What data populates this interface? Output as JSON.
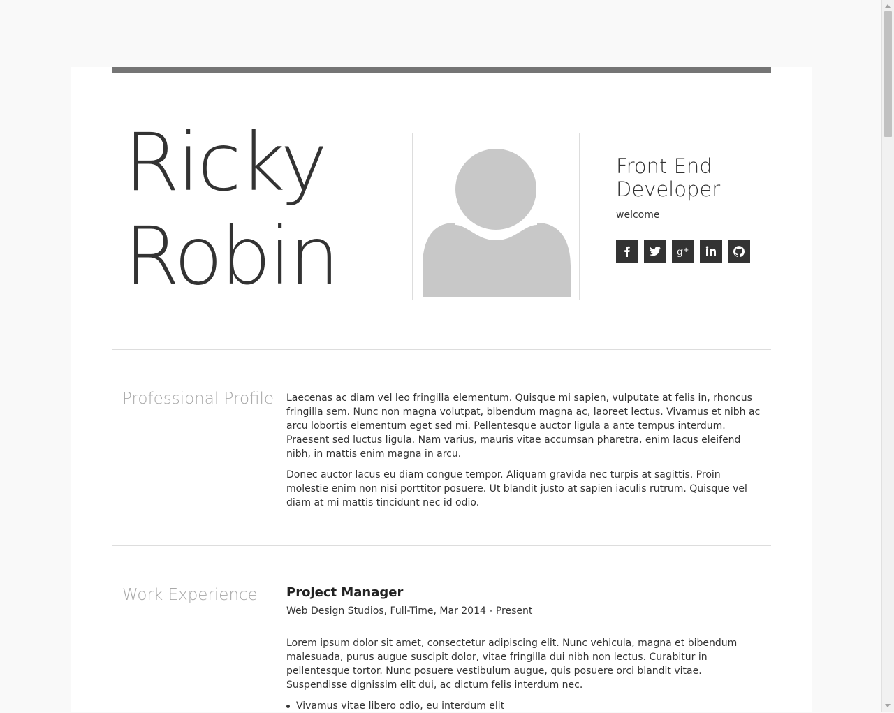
{
  "header": {
    "first_name": "Ricky",
    "last_name": "Robin",
    "role_line1": "Front End",
    "role_line2": "Developer",
    "tagline": "welcome"
  },
  "social": [
    {
      "name": "facebook-icon",
      "glyph": "f"
    },
    {
      "name": "twitter-icon",
      "glyph": "twitter"
    },
    {
      "name": "google-plus-icon",
      "glyph": "g+"
    },
    {
      "name": "linkedin-icon",
      "glyph": "in"
    },
    {
      "name": "github-icon",
      "glyph": "github"
    }
  ],
  "profile": {
    "title": "Professional Profile",
    "paragraphs": [
      "Laecenas ac diam vel leo fringilla elementum. Quisque mi sapien, vulputate at felis in, rhoncus fringilla sem. Nunc non magna volutpat, bibendum magna ac, laoreet lectus. Vivamus et nibh ac arcu lobortis elementum eget sed mi. Pellentesque auctor ligula a ante tempus interdum. Praesent sed luctus ligula. Nam varius, mauris vitae accumsan pharetra, enim lacus eleifend nibh, in mattis enim magna in arcu.",
      "Donec auctor lacus eu diam congue tempor. Aliquam gravida nec turpis at sagittis. Proin molestie enim non nisi porttitor posuere. Ut blandit justo at sapien iaculis rutrum. Quisque vel diam at mi mattis tincidunt nec id odio."
    ]
  },
  "experience": {
    "title": "Work Experience",
    "jobs": [
      {
        "title": "Project Manager",
        "meta": "Web Design Studios, Full-Time, Mar 2014 - Present",
        "description": "Lorem ipsum dolor sit amet, consectetur adipiscing elit. Nunc vehicula, magna et bibendum malesuada, purus augue suscipit dolor, vitae fringilla dui nibh non lectus. Curabitur in pellentesque tortor. Nunc posuere vestibulum augue, quis posuere orci blandit vitae. Suspendisse dignissim elit dui, ac dictum felis interdum nec.",
        "bullets": [
          "Vivamus vitae libero odio, eu interdum elit"
        ]
      }
    ]
  },
  "colors": {
    "accent_bar": "#757575",
    "section_title": "#a8a8a8",
    "social_bg": "#333333",
    "text": "#333333"
  }
}
